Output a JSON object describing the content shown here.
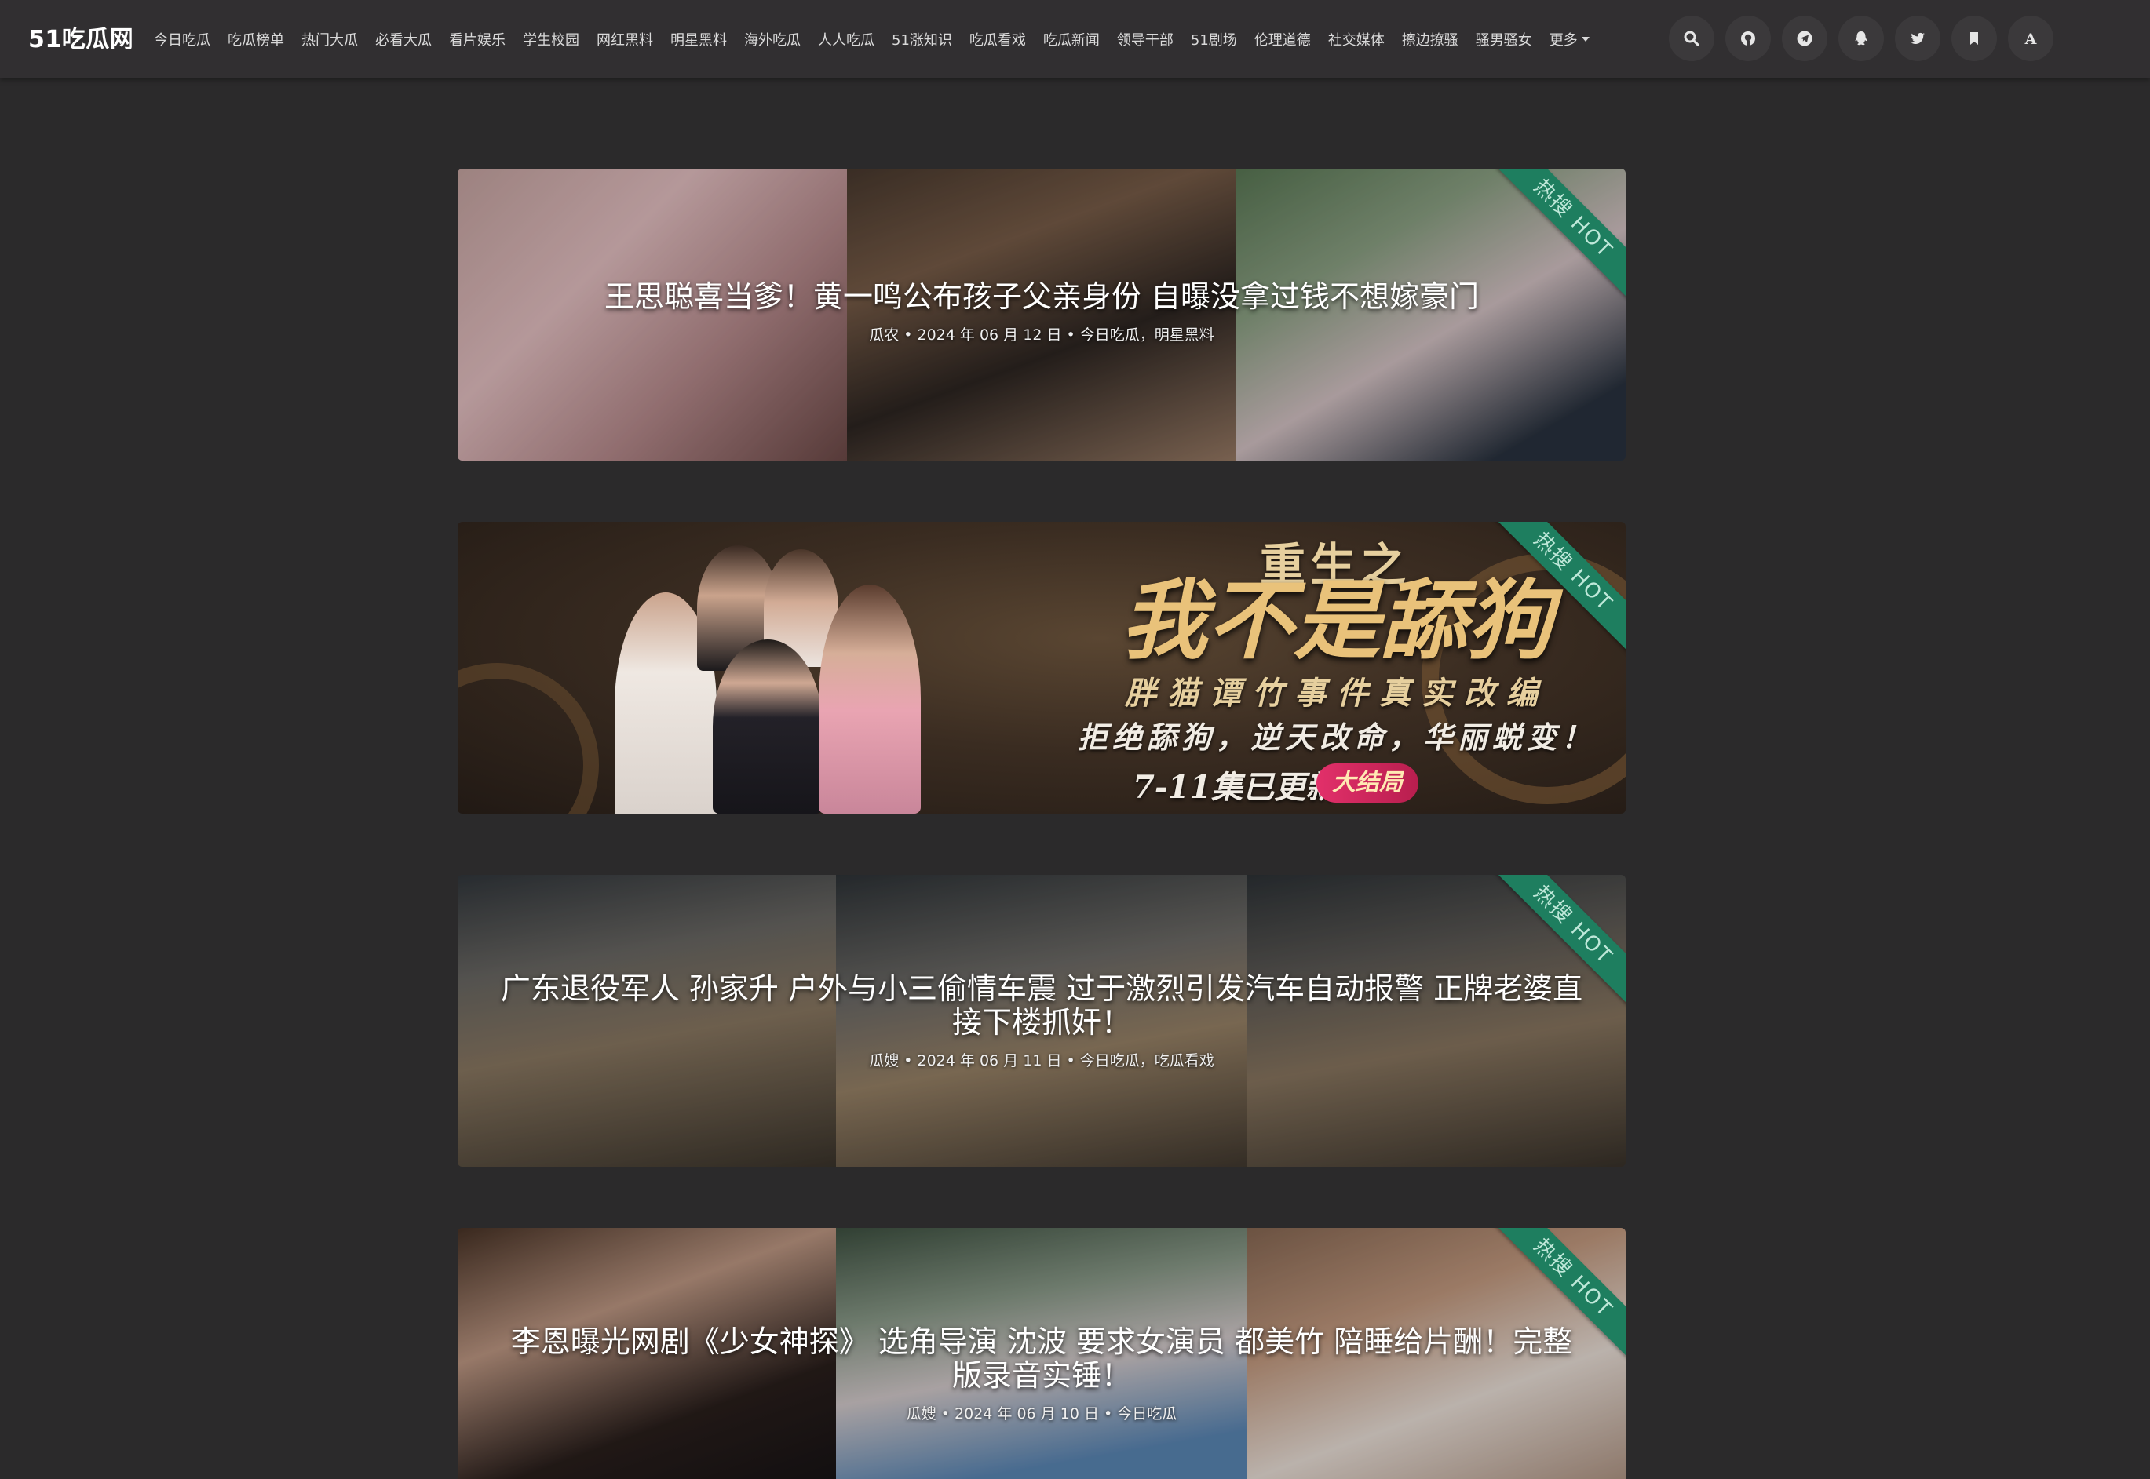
{
  "site": {
    "logo": "51吃瓜网"
  },
  "nav": {
    "items": [
      "今日吃瓜",
      "吃瓜榜单",
      "热门大瓜",
      "必看大瓜",
      "看片娱乐",
      "学生校园",
      "网红黑料",
      "明星黑料",
      "海外吃瓜",
      "人人吃瓜",
      "51涨知识",
      "吃瓜看戏",
      "吃瓜新闻",
      "领导干部",
      "51剧场",
      "伦理道德",
      "社交媒体",
      "擦边撩骚",
      "骚男骚女"
    ],
    "more": "更多"
  },
  "nav_icons": [
    "search-icon",
    "github-icon",
    "telegram-icon",
    "qq-icon",
    "twitter-icon",
    "bookmark-icon",
    "font-icon"
  ],
  "hot_label": "热搜 HOT",
  "posts": [
    {
      "title": "王思聪喜当爹！黄一鸣公布孩子父亲身份 自曝没拿过钱不想嫁豪门",
      "meta": "瓜农 • 2024 年 06 月 12 日 • 今日吃瓜，明星黑料"
    },
    {
      "title": "广东退役军人 孙家升 户外与小三偷情车震 过于激烈引发汽车自动报警 正牌老婆直接下楼抓奸！",
      "meta": "瓜嫂 • 2024 年 06 月 11 日 • 今日吃瓜，吃瓜看戏"
    },
    {
      "title": "李恩曝光网剧《少女神探》 选角导演 沈波 要求女演员 都美竹 陪睡给片酬！完整版录音实锤！",
      "meta": "瓜嫂 • 2024 年 06 月 10 日 • 今日吃瓜"
    }
  ],
  "ad": {
    "line1": "重生之",
    "line2": "我不是舔狗",
    "line3": "胖猫谭竹事件真实改编",
    "line4": "拒绝舔狗，逆天改命，华丽蜕变！",
    "line5": "7-11集已更新",
    "badge": "大结局"
  },
  "colors": {
    "background": "#2b2a2b",
    "navbar": "#312f31",
    "hot_ribbon": "#1e7e5f"
  }
}
